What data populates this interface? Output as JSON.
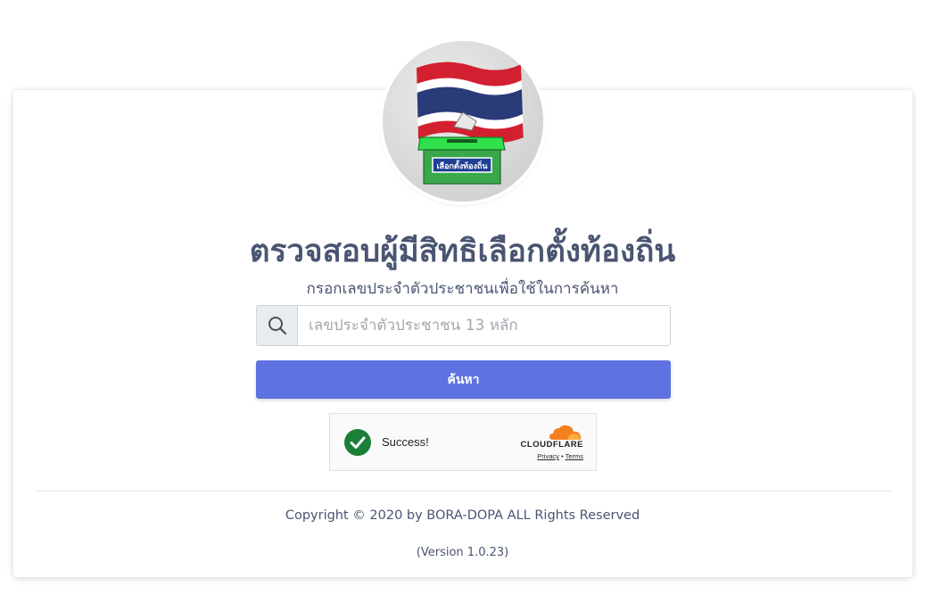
{
  "header": {
    "logo_label": "เลือกตั้งท้องถิ่น"
  },
  "main": {
    "title": "ตรวจสอบผู้มีสิทธิเลือกตั้งท้องถิ่น",
    "subtitle": "กรอกเลขประจำตัวประชาชนเพื่อใช้ในการค้นหา",
    "search": {
      "icon": "search-icon",
      "value": "",
      "placeholder": "เลขประจำตัวประชาชน 13 หลัก"
    },
    "search_button_label": "ค้นหา"
  },
  "captcha": {
    "status": "Success!",
    "brand": "CLOUDFLARE",
    "privacy_label": "Privacy",
    "separator": "•",
    "terms_label": "Terms",
    "check_color": "#1a7f37",
    "cloud_color": "#f48120"
  },
  "footer": {
    "copyright": "Copyright © 2020 by BORA-DOPA ALL Rights Reserved",
    "version": "(Version 1.0.23)"
  },
  "colors": {
    "accent": "#5f72e2",
    "text": "#4a5572"
  }
}
